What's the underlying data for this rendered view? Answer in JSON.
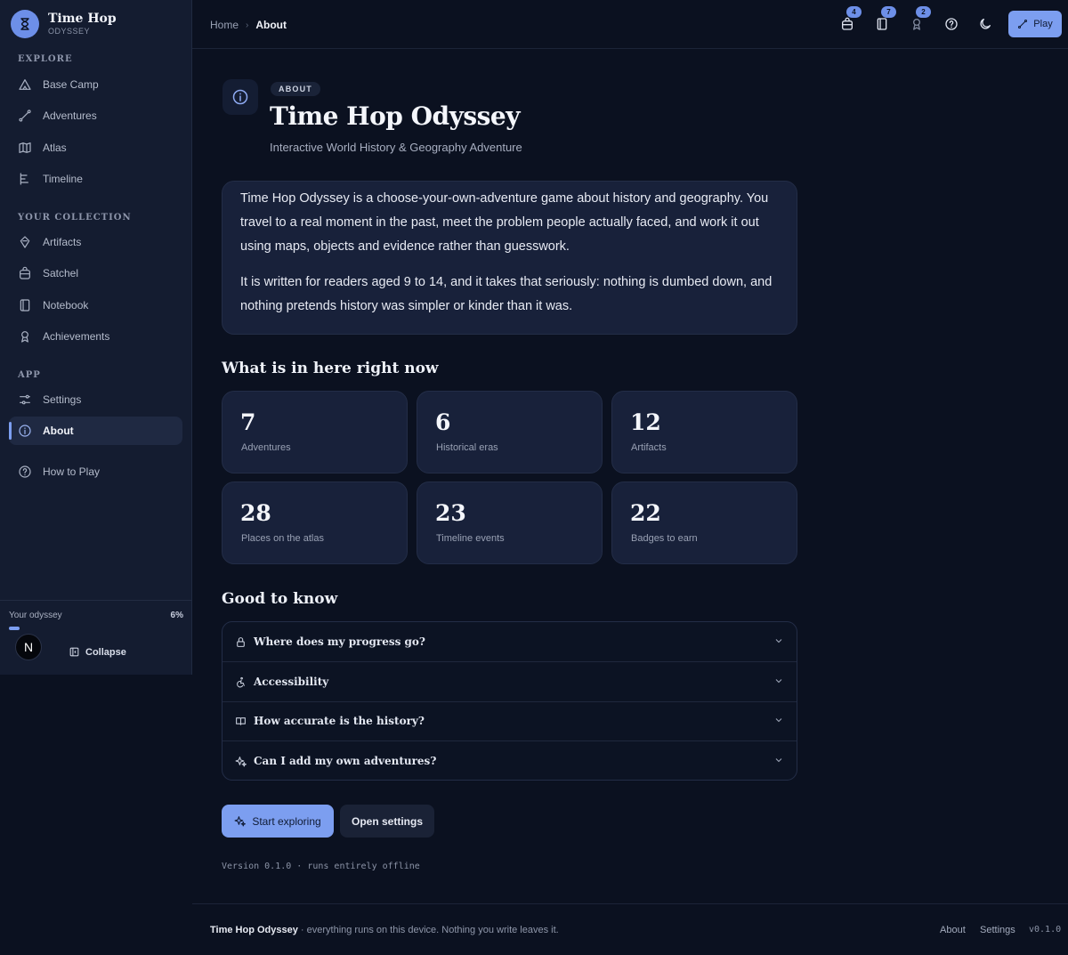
{
  "brand": {
    "name": "Time Hop",
    "tagline": "ODYSSEY"
  },
  "sidebar": {
    "sections": [
      {
        "label": "EXPLORE"
      },
      {
        "label": "YOUR COLLECTION"
      },
      {
        "label": "APP"
      }
    ],
    "items": [
      {
        "label": "Base Camp",
        "icon": "mountain-icon"
      },
      {
        "label": "Adventures",
        "icon": "route-icon"
      },
      {
        "label": "Atlas",
        "icon": "map-icon"
      },
      {
        "label": "Timeline",
        "icon": "timeline-icon"
      },
      {
        "label": "Artifacts",
        "icon": "gem-icon"
      },
      {
        "label": "Satchel",
        "icon": "backpack-icon"
      },
      {
        "label": "Notebook",
        "icon": "notebook-icon"
      },
      {
        "label": "Achievements",
        "icon": "award-icon"
      },
      {
        "label": "Settings",
        "icon": "sliders-icon"
      },
      {
        "label": "About",
        "icon": "info-icon",
        "active": true
      },
      {
        "label": "How to Play",
        "icon": "help-icon"
      }
    ],
    "odyssey": {
      "label": "Your odyssey",
      "percent_label": "6%",
      "progress": 6
    },
    "avatar_letter": "N",
    "collapse_label": "Collapse"
  },
  "header": {
    "breadcrumb": {
      "home": "Home",
      "current": "About"
    },
    "badges": {
      "satchel": "4",
      "notebook": "7",
      "achievements": "2"
    },
    "play_label": "Play"
  },
  "main": {
    "chip": "ABOUT",
    "title": "Time Hop Odyssey",
    "subtitle": "Interactive World History & Geography Adventure",
    "intro": [
      "Time Hop Odyssey is a choose-your-own-adventure game about history and geography. You travel to a real moment in the past, meet the problem people actually faced, and work it out using maps, objects and evidence rather than guesswork.",
      "It is written for readers aged 9 to 14, and it takes that seriously: nothing is dumbed down, and nothing pretends history was simpler or kinder than it was."
    ],
    "stats_heading": "What is in here right now",
    "stats": [
      {
        "value": "7",
        "label": "Adventures"
      },
      {
        "value": "6",
        "label": "Historical eras"
      },
      {
        "value": "12",
        "label": "Artifacts"
      },
      {
        "value": "28",
        "label": "Places on the atlas"
      },
      {
        "value": "23",
        "label": "Timeline events"
      },
      {
        "value": "22",
        "label": "Badges to earn"
      }
    ],
    "faq_heading": "Good to know",
    "faq": [
      {
        "question": "Where does my progress go?",
        "icon": "lock-icon"
      },
      {
        "question": "Accessibility",
        "icon": "accessibility-icon"
      },
      {
        "question": "How accurate is the history?",
        "icon": "book-open-icon"
      },
      {
        "question": "Can I add my own adventures?",
        "icon": "sparkles-icon"
      }
    ],
    "primary_button": "Start exploring",
    "secondary_button": "Open settings",
    "version_line": "Version 0.1.0 · runs entirely offline"
  },
  "footer": {
    "app_name": "Time Hop Odyssey",
    "tagline": " · everything runs on this device. Nothing you write leaves it.",
    "links": [
      "About",
      "Settings"
    ],
    "version": "v0.1.0"
  },
  "colors": {
    "accent": "#7c9ef0",
    "background": "#0b1120",
    "panel": "#141c30",
    "card": "#18213a"
  }
}
